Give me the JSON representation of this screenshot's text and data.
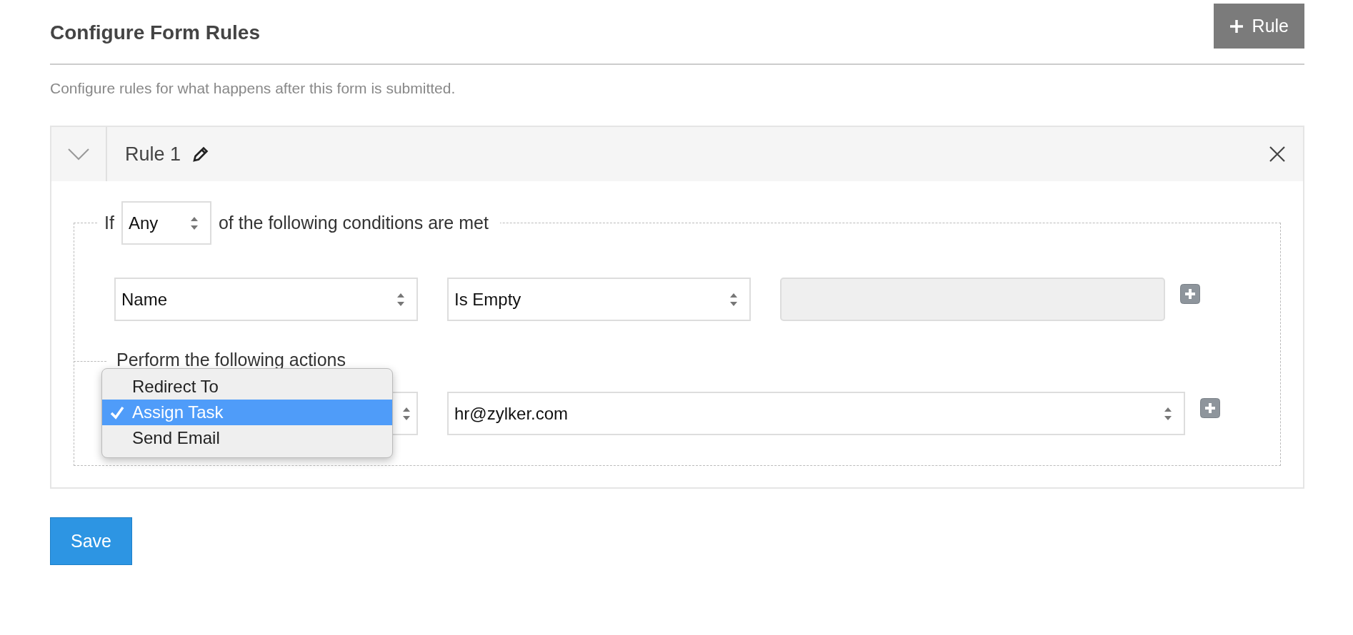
{
  "header": {
    "title": "Configure Form Rules",
    "add_button": "Rule"
  },
  "description": "Configure rules for what happens after this form is submitted.",
  "rule": {
    "expanded": true,
    "name": "Rule 1",
    "conditions": {
      "prefix": "If",
      "match": "Any",
      "suffix": "of the following conditions are met",
      "rows": [
        {
          "field": "Name",
          "operator": "Is Empty",
          "value_disabled": true
        }
      ]
    },
    "actions": {
      "heading": "Perform the following actions",
      "rows": [
        {
          "target": "hr@zylker.com",
          "menu_open": true,
          "options": [
            {
              "label": "Redirect To",
              "selected": false
            },
            {
              "label": "Assign Task",
              "selected": true
            },
            {
              "label": "Send Email",
              "selected": false
            }
          ]
        }
      ]
    }
  },
  "save_button": "Save"
}
